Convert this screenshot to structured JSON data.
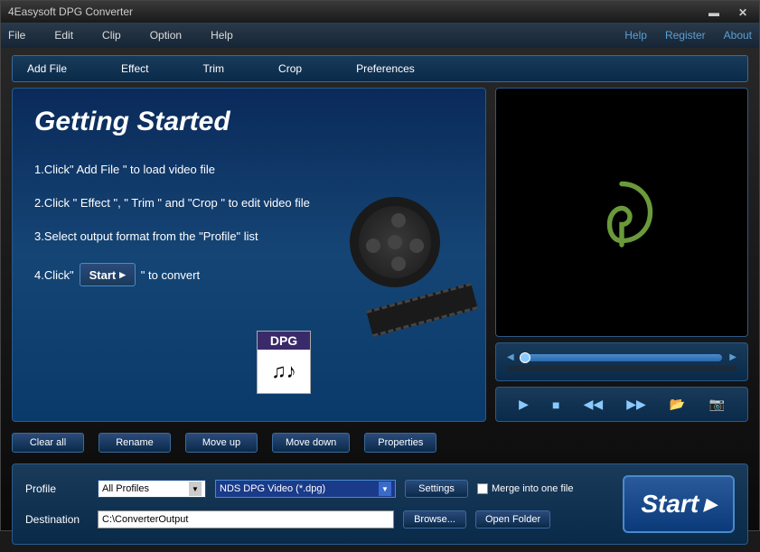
{
  "app": {
    "title": "4Easysoft DPG Converter"
  },
  "menubar": {
    "left": [
      "File",
      "Edit",
      "Clip",
      "Option",
      "Help"
    ],
    "right": [
      "Help",
      "Register",
      "About"
    ]
  },
  "toolbar": [
    "Add File",
    "Effect",
    "Trim",
    "Crop",
    "Preferences"
  ],
  "getting_started": {
    "title": "Getting Started",
    "step1": "1.Click\" Add File \" to load video file",
    "step2": "2.Click \" Effect \", \" Trim \" and \"Crop \" to edit video file",
    "step3": "3.Select output format from the \"Profile\" list",
    "step4_pre": "4.Click\"",
    "step4_btn": "Start",
    "step4_post": "\" to convert",
    "dpg_label": "DPG"
  },
  "action_buttons": [
    "Clear all",
    "Rename",
    "Move up",
    "Move down",
    "Properties"
  ],
  "player": {
    "play": "▶",
    "stop": "■",
    "prev": "◀◀",
    "next": "▶▶",
    "open": "📂",
    "snap": "📷"
  },
  "bottom": {
    "profile_label": "Profile",
    "profile_combo1": "All Profiles",
    "profile_combo2": "NDS DPG Video (*.dpg)",
    "settings_btn": "Settings",
    "merge_label": "Merge into one file",
    "destination_label": "Destination",
    "destination_value": "C:\\ConverterOutput",
    "browse_btn": "Browse...",
    "open_folder_btn": "Open Folder",
    "start_btn": "Start"
  }
}
